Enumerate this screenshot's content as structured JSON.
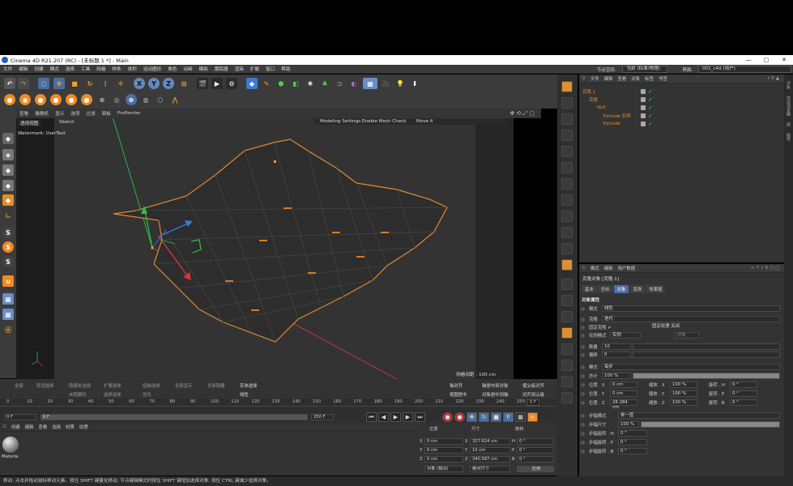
{
  "window": {
    "title": "Cinema 4D R21.207 (RC) - [未标题 1 *] - Main",
    "min": "—",
    "max": "▢",
    "close": "✕"
  },
  "menu": [
    "文件",
    "编辑",
    "创建",
    "模式",
    "选择",
    "工具",
    "网格",
    "样条",
    "体积",
    "运动图形",
    "角色",
    "动画",
    "模拟",
    "跟踪器",
    "渲染",
    "扩展",
    "窗口",
    "帮助"
  ],
  "menu_right": {
    "node_space_label": "节点空间:",
    "node_space_value": "当前 (标准/物理)",
    "layout_label": "界面:",
    "layout_value": "001_c4d (用户)"
  },
  "viewport_menu": [
    "查看",
    "摄像机",
    "显示",
    "选项",
    "过滤",
    "面板",
    "ProRender"
  ],
  "viewport": {
    "name": "透视视图",
    "sketch": "Sketch",
    "watermark": "Watermark: UserText",
    "mode_info": "Modeling Settings.Enable Mesh Check",
    "move_label": "Move 4",
    "grid_spacing": "网格间距 : 100 cm"
  },
  "obj_panel": {
    "menu": [
      "文件",
      "编辑",
      "查看",
      "对象",
      "标签",
      "书签"
    ],
    "items": [
      {
        "name": "克隆.1",
        "indent": 0
      },
      {
        "name": "克隆",
        "indent": 1
      },
      {
        "name": "Null",
        "indent": 2
      },
      {
        "name": "Extrude 实例",
        "indent": 3
      },
      {
        "name": "Extrude",
        "indent": 3
      }
    ]
  },
  "attr_panel": {
    "menu": [
      "模式",
      "编辑",
      "用户数据"
    ],
    "title": "克隆对象 [克隆.1]",
    "tabs": [
      "基本",
      "坐标",
      "对象",
      "变换",
      "效果器"
    ],
    "active_tab": "对象",
    "section": "对象属性",
    "rows": [
      {
        "label": "模式",
        "value": "线性"
      },
      {
        "label": "克隆",
        "value": "迭代"
      },
      {
        "label": "固定克隆 ✔",
        "value": "固定纹理  关闭"
      },
      {
        "label": "实例模式",
        "value": "实例"
      },
      {
        "label": "数量",
        "value": "10"
      },
      {
        "label": "偏移",
        "value": "0"
      },
      {
        "label": "模式",
        "value": "每步"
      },
      {
        "label": "总计",
        "value": "100 %"
      },
      {
        "label": "位置 . X",
        "value": "0 cm"
      },
      {
        "label": "位置 . Y",
        "value": "0 cm"
      },
      {
        "label": "位置 . Z",
        "value": "28.284 cm"
      },
      {
        "label": "步幅模式",
        "value": "单一值"
      },
      {
        "label": "步幅尺寸",
        "value": "100 %"
      },
      {
        "label": "步幅旋转 . H",
        "value": "0 °"
      },
      {
        "label": "步幅旋转 . P",
        "value": "0 °"
      },
      {
        "label": "步幅旋转 . B",
        "value": "0 °"
      }
    ],
    "scale": [
      {
        "label": "缩放 . X",
        "value": "100 %"
      },
      {
        "label": "缩放 . Y",
        "value": "100 %"
      },
      {
        "label": "缩放 . Z",
        "value": "100 %"
      }
    ],
    "rotate": [
      {
        "label": "旋转 . H",
        "value": "0 °"
      },
      {
        "label": "旋转 . P",
        "value": "0 °"
      },
      {
        "label": "旋转 . B",
        "value": "0 °"
      }
    ],
    "extra": {
      "fix_texture_label": "固定纹理",
      "fix_texture_value": "关闭",
      "blend_mode": "实例",
      "blend_object": "对象"
    }
  },
  "commands": [
    "全部",
    "取消选择",
    "隐藏未选择",
    "扩展选择",
    "扭曲选择",
    "全部显示",
    "全部隐藏",
    "未隐藏的",
    "选择选择",
    "优化",
    "实体选择",
    "线性"
  ],
  "commands_right": [
    "轴对齐",
    "轴居中到对象",
    "使父级对齐",
    "视图居中",
    "对象居中到轴",
    "对齐到父级"
  ],
  "timeline": {
    "ticks": [
      "0",
      "10",
      "20",
      "30",
      "40",
      "50",
      "60",
      "70",
      "80",
      "90",
      "100",
      "110",
      "120",
      "130",
      "140",
      "150",
      "160",
      "170",
      "180",
      "190",
      "200",
      "210",
      "220",
      "230",
      "240",
      "250"
    ],
    "current": "0 F",
    "start": "0 F",
    "end": "250 F",
    "end2": "250 F",
    "frame": "0 F"
  },
  "material": {
    "menu": [
      "创建",
      "编辑",
      "查看",
      "选择",
      "材质",
      "纹理"
    ],
    "name": "Materia"
  },
  "coords": {
    "headers": [
      "位置",
      "尺寸",
      "旋转"
    ],
    "rows": [
      {
        "axis": "X",
        "pos": "0 cm",
        "size_axis": "X",
        "size": "327.624 cm",
        "rot_axis": "H",
        "rot": "0 °"
      },
      {
        "axis": "Y",
        "pos": "0 cm",
        "size_axis": "Y",
        "size": "10 cm",
        "rot_axis": "P",
        "rot": "0 °"
      },
      {
        "axis": "Z",
        "pos": "0 cm",
        "size_axis": "Z",
        "size": "340.587 cm",
        "rot_axis": "B",
        "rot": "0 °"
      }
    ],
    "mode": "对象 (相对)",
    "size_mode": "绝对尺寸",
    "apply": "应用"
  },
  "status": "移动: 点击并拖动鼠标移动元素。按住 SHIFT 键量化移动; 节点编辑模式时按住 SHIFT 键增加选择对象; 按住 CTRL 键减少选择对象。",
  "right_edge": [
    "对象",
    "内容浏览器",
    "层",
    "属性"
  ],
  "colors": {
    "accent": "#f08a24",
    "active_tab": "#4a6fa5",
    "bg": "#333333"
  }
}
